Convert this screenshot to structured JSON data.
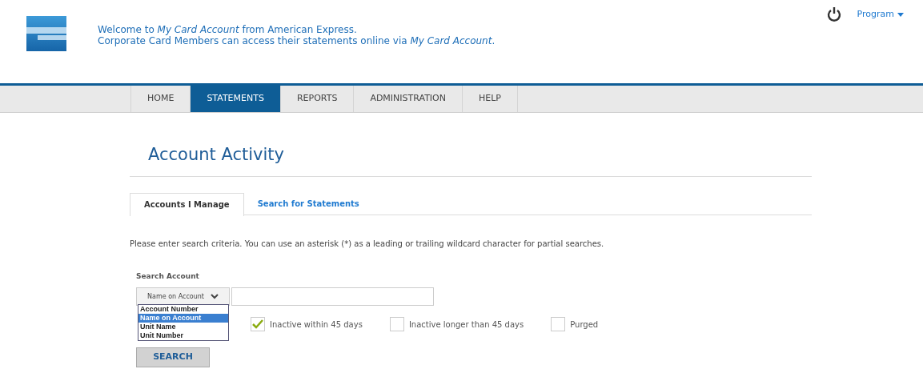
{
  "header": {
    "welcome_lines": [
      "Welcome to *My Card Account* from American Express.",
      "Corporate Card Members can access their statements online via *My Card Account*."
    ],
    "program_menu": "Program"
  },
  "nav": [
    {
      "label": "HOME",
      "selected": false
    },
    {
      "label": "STATEMENTS",
      "selected": true
    },
    {
      "label": "REPORTS",
      "selected": false
    },
    {
      "label": "ADMINISTRATION",
      "selected": false
    },
    {
      "label": "HELP",
      "selected": false
    }
  ],
  "page_title": "Account Activity",
  "tabs": [
    {
      "label": "Accounts I Manage",
      "selected": true
    },
    {
      "label": "Search for Statements",
      "selected": false
    }
  ],
  "instructions": "Please enter search criteria. You can use an asterisk (*) as a leading or trailing wildcard character for partial searches.",
  "search": {
    "label": "Search Account",
    "select_value": "Name on Account",
    "options": [
      {
        "label": "Account Number",
        "selected": false
      },
      {
        "label": "Name on Account",
        "selected": true
      },
      {
        "label": "Unit Name",
        "selected": false
      },
      {
        "label": "Unit Number",
        "selected": false
      }
    ]
  },
  "filters": [
    {
      "label": "Inactive within 45 days",
      "checked": true
    },
    {
      "label": "Inactive longer than 45 days",
      "checked": false
    },
    {
      "label": "Purged",
      "checked": false
    }
  ],
  "search_button": "SEARCH"
}
